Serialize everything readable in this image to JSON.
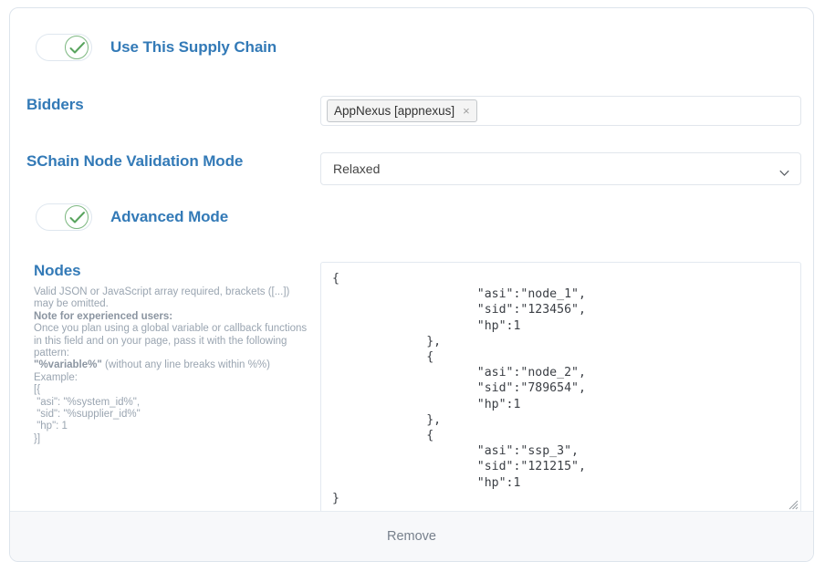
{
  "use_supply_chain": {
    "label": "Use This Supply Chain",
    "state": "on"
  },
  "bidders": {
    "label": "Bidders",
    "tags": [
      {
        "text": "AppNexus [appnexus]",
        "remove_glyph": "×"
      }
    ]
  },
  "validation_mode": {
    "label": "SChain Node Validation Mode",
    "value": "Relaxed"
  },
  "advanced_mode": {
    "label": "Advanced Mode",
    "state": "on"
  },
  "nodes": {
    "label": "Nodes",
    "help": {
      "line1": "Valid JSON or JavaScript array required, brackets ([...]) may be omitted.",
      "note_heading": "Note for experienced users:",
      "line2": "Once you plan using a global variable or callback functions in this field and on your page, pass it with the following pattern:",
      "pattern": "\"%variable%\"",
      "line3": " (without any line breaks within %%)",
      "example_heading": "Example:",
      "example_code": "[{\n \"asi\": \"%system_id%\",\n \"sid\": \"%supplier_id%\"\n \"hp\": 1\n}]"
    },
    "value": "{\n                    \"asi\":\"node_1\",\n                    \"sid\":\"123456\",\n                    \"hp\":1\n             },\n             {\n                    \"asi\":\"node_2\",\n                    \"sid\":\"789654\",\n                    \"hp\":1\n             },\n             {\n                    \"asi\":\"ssp_3\",\n                    \"sid\":\"121215\",\n                    \"hp\":1\n}"
  },
  "footer": {
    "remove_label": "Remove"
  },
  "colors": {
    "accent_blue": "#337ab7",
    "toggle_green": "#59a45e",
    "border": "#dde4ec",
    "footer_bg": "#f7f8fa",
    "help_text": "#9aa5b1"
  }
}
